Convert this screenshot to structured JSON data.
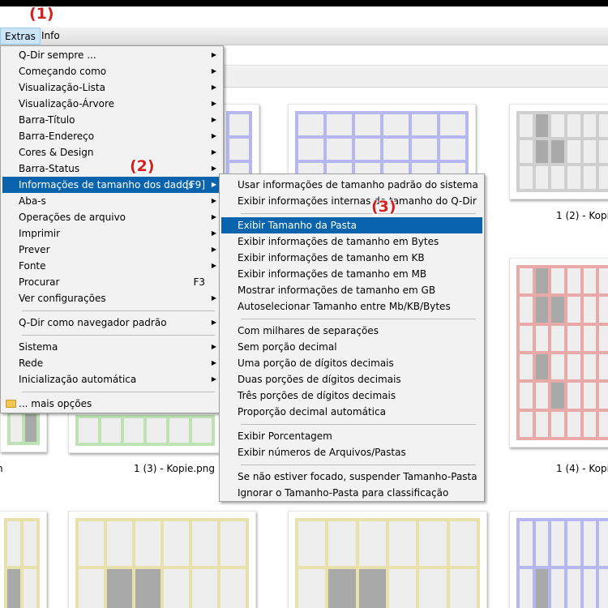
{
  "menubar": {
    "extras": "Extras",
    "info": "Info"
  },
  "annotations": {
    "a1": "(1)",
    "a2": "(2)",
    "a3": "(3)"
  },
  "main_menu": {
    "items": [
      "Q-Dir sempre ...",
      "Começando como",
      "Visualização-Lista",
      "Visualização-Árvore",
      "Barra-Título",
      "Barra-Endereço",
      "Cores & Design",
      "Barra-Status",
      "Informações de tamanho dos dados",
      "Aba-s",
      "Operações de arquivo",
      "Imprimir",
      "Prever",
      "Fonte",
      "Procurar",
      "Ver configurações",
      "Q-Dir como navegador padrão",
      "Sistema",
      "Rede",
      "Inicialização automática",
      "... mais opções"
    ],
    "shortcut_info": "[F9]",
    "shortcut_search": "F3"
  },
  "sub_menu": {
    "items": [
      "Usar informações de tamanho padrão do sistema",
      "Exibir informações internas de tamanho do Q-Dir",
      "Exibir Tamanho da Pasta",
      "Exibir informações de tamanho em Bytes",
      "Exibir informações de tamanho em KB",
      "Exibir informações de tamanho em MB",
      "Mostrar informações de tamanho em GB",
      "Autoselecionar Tamanho entre Mb/KB/Bytes",
      "Com milhares de separações",
      "Sem porção decimal",
      "Uma porção de dígitos decimais",
      "Duas porções de dígitos decimais",
      "Três porções de dígitos decimais",
      "Proporção decimal automática",
      "Exibir Porcentagem",
      "Exibir números de Arquivos/Pastas",
      "Se não estiver focado, suspender Tamanho-Pasta",
      "Ignorar o Tamanho-Pasta para classificação"
    ]
  },
  "gallery": {
    "captions": [
      "1 (2) - Kopie",
      "1 (3) - Kopie.png",
      "1 (4) - Kopie",
      "n"
    ]
  },
  "colors": {
    "highlight": "#0a64ad",
    "annotation": "#d32020",
    "blue_tint": "#b7b7f0",
    "gray_tint": "#cfcfcf",
    "red_tint": "#eaa9a9",
    "green_tint": "#bde3b4",
    "yellow_tint": "#e9e1ac"
  }
}
